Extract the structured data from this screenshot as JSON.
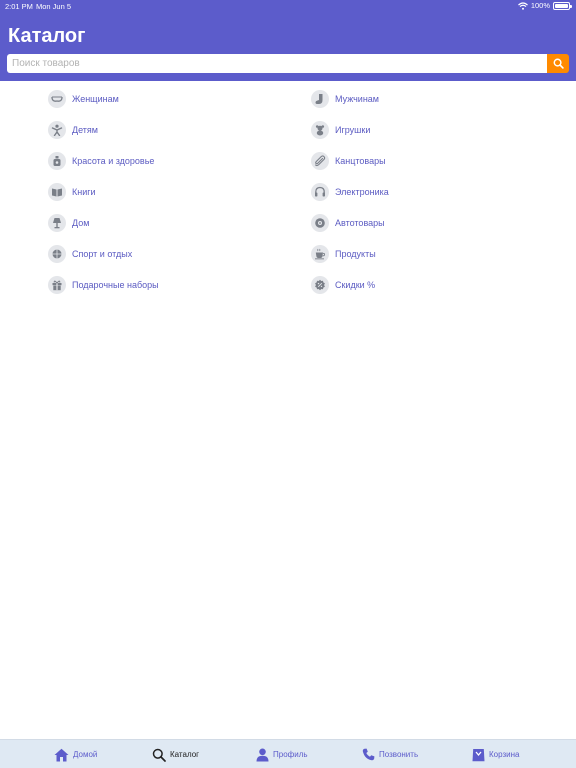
{
  "status_bar": {
    "time": "2:01 PM",
    "date": "Mon Jun 5",
    "battery": "100%"
  },
  "header": {
    "title": "Каталог"
  },
  "search": {
    "placeholder": "Поиск товаров"
  },
  "categories": {
    "left": [
      {
        "label": "Женщинам",
        "icon": "bra-icon"
      },
      {
        "label": "Детям",
        "icon": "child-icon"
      },
      {
        "label": "Красота и здоровье",
        "icon": "perfume-icon"
      },
      {
        "label": "Книги",
        "icon": "book-icon"
      },
      {
        "label": "Дом",
        "icon": "lamp-icon"
      },
      {
        "label": "Спорт и отдых",
        "icon": "ball-icon"
      },
      {
        "label": "Подарочные наборы",
        "icon": "gift-icon"
      }
    ],
    "right": [
      {
        "label": "Мужчинам",
        "icon": "sock-icon"
      },
      {
        "label": "Игрушки",
        "icon": "teddy-bear-icon"
      },
      {
        "label": "Канцтовары",
        "icon": "paperclip-icon"
      },
      {
        "label": "Электроника",
        "icon": "headphones-icon"
      },
      {
        "label": "Автотовары",
        "icon": "wheel-icon"
      },
      {
        "label": "Продукты",
        "icon": "coffee-cup-icon"
      },
      {
        "label": "Скидки %",
        "icon": "discount-icon"
      }
    ]
  },
  "tabbar": {
    "items": [
      {
        "label": "Домой",
        "icon": "home-icon"
      },
      {
        "label": "Каталог",
        "icon": "search-icon"
      },
      {
        "label": "Профиль",
        "icon": "person-icon"
      },
      {
        "label": "Позвонить",
        "icon": "phone-icon"
      },
      {
        "label": "Корзина",
        "icon": "shopping-bag-icon"
      }
    ],
    "active": "Каталог"
  },
  "colors": {
    "primary": "#5c5ccb",
    "accent": "#ff8a00",
    "icon_bg": "#e4e6ea",
    "tabbar_bg": "#dfe9f3"
  }
}
